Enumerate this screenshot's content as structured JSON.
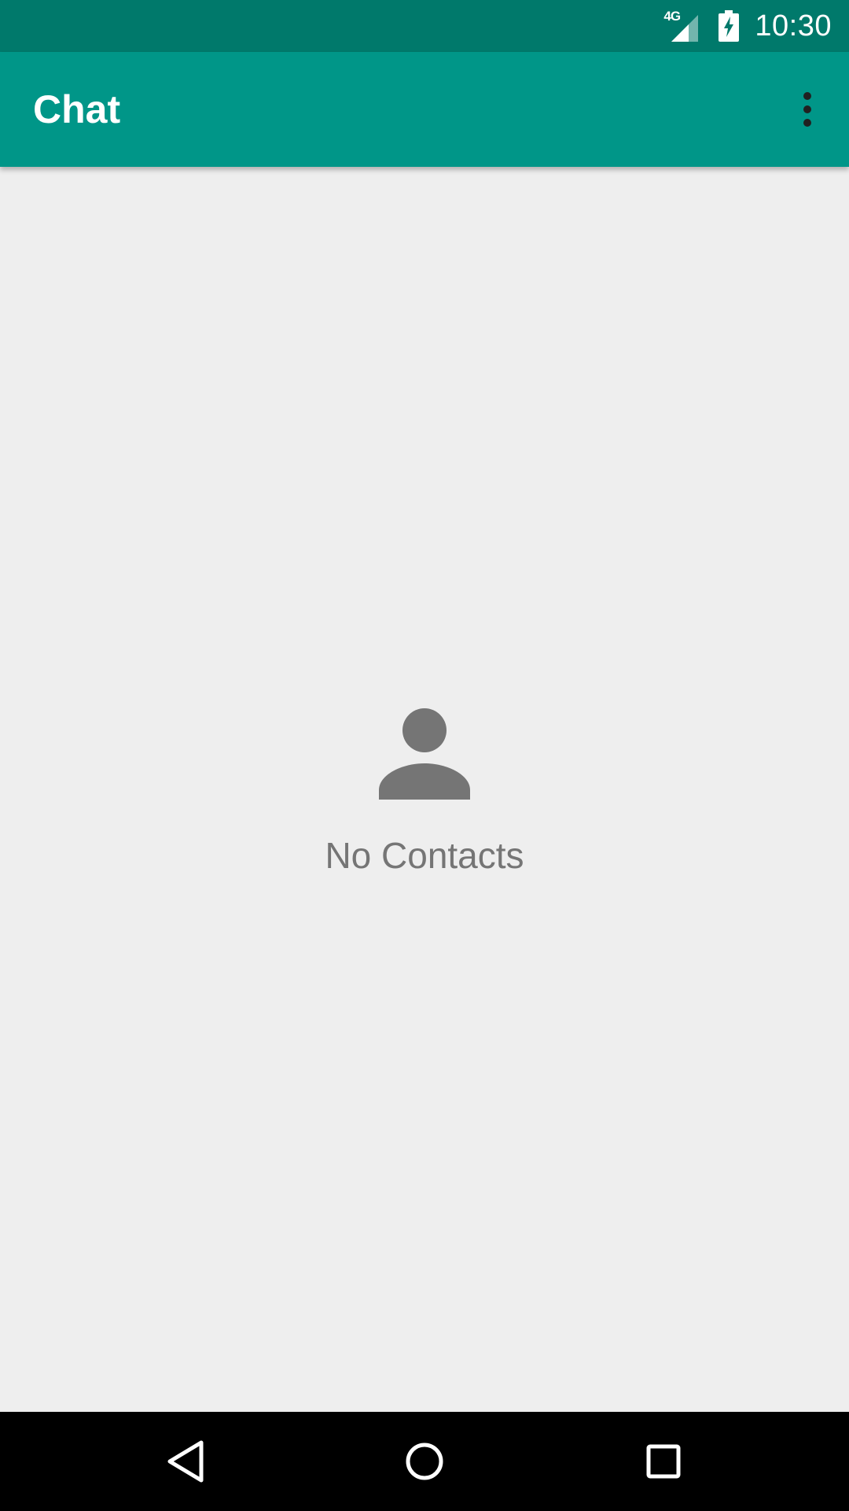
{
  "status_bar": {
    "network": "4G",
    "time": "10:30",
    "icons": [
      "signal-icon",
      "battery-charging-icon"
    ]
  },
  "app_bar": {
    "title": "Chat",
    "menu_icon": "more-vert-icon"
  },
  "empty_state": {
    "icon": "person-icon",
    "message": "No Contacts"
  },
  "nav_bar": {
    "icons": [
      "back-icon",
      "home-icon",
      "recents-icon"
    ]
  },
  "colors": {
    "status_bar": "#00796B",
    "app_bar": "#009688",
    "background": "#EEEEEE",
    "empty_icon": "#757575",
    "nav_bar": "#000000"
  }
}
